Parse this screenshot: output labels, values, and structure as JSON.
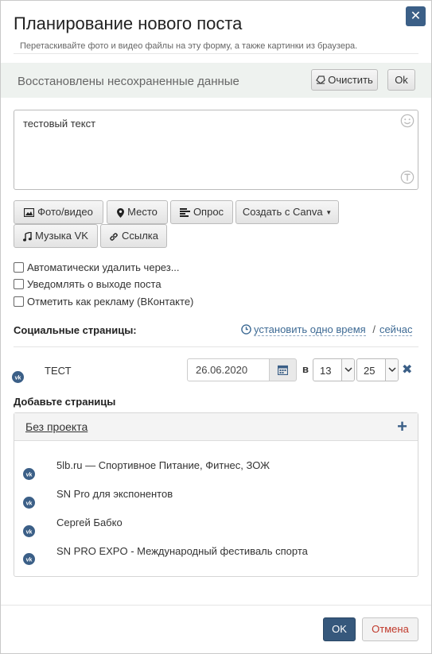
{
  "dialog": {
    "title": "Планирование нового поста",
    "close_glyph": "✕",
    "hint": "Перетаскивайте фото и видео файлы на эту форму, а также картинки из браузера."
  },
  "restore": {
    "message": "Восстановлены несохраненные данные",
    "clear_label": "Очистить",
    "ok_label": "Ok"
  },
  "editor": {
    "text": "тестовый текст"
  },
  "toolbar": {
    "photo_label": "Фото/видео",
    "place_label": "Место",
    "poll_label": "Опрос",
    "canva_label": "Создать с Canva",
    "music_label": "Музыка VK",
    "link_label": "Ссылка"
  },
  "options": [
    "Автоматически удалить через...",
    "Уведомлять о выходе поста",
    "Отметить как рекламу (ВКонтакте)"
  ],
  "social": {
    "title": "Социальные страницы:",
    "set_time": "установить одно время",
    "slash": "/",
    "now": "сейчас",
    "account": {
      "name": "ТЕСТ",
      "date": "26.06.2020",
      "at_label": "в",
      "hour": "13",
      "minute": "25",
      "remove_glyph": "✖"
    }
  },
  "add_pages": {
    "title": "Добавьте страницы",
    "project": "Без проекта",
    "plus_glyph": "+",
    "pages": [
      "5lb.ru — Спортивное Питание, Фитнес, ЗОЖ",
      "SN Pro для экспонентов",
      "Сергей Бабко",
      "SN PRO EXPO - Международный фестиваль спорта"
    ]
  },
  "footer": {
    "ok_label": "OK",
    "cancel_label": "Отмена"
  },
  "colors": {
    "accent": "#36587c",
    "cancel_text": "#c0392b",
    "restore_bg": "#eef2ef"
  }
}
